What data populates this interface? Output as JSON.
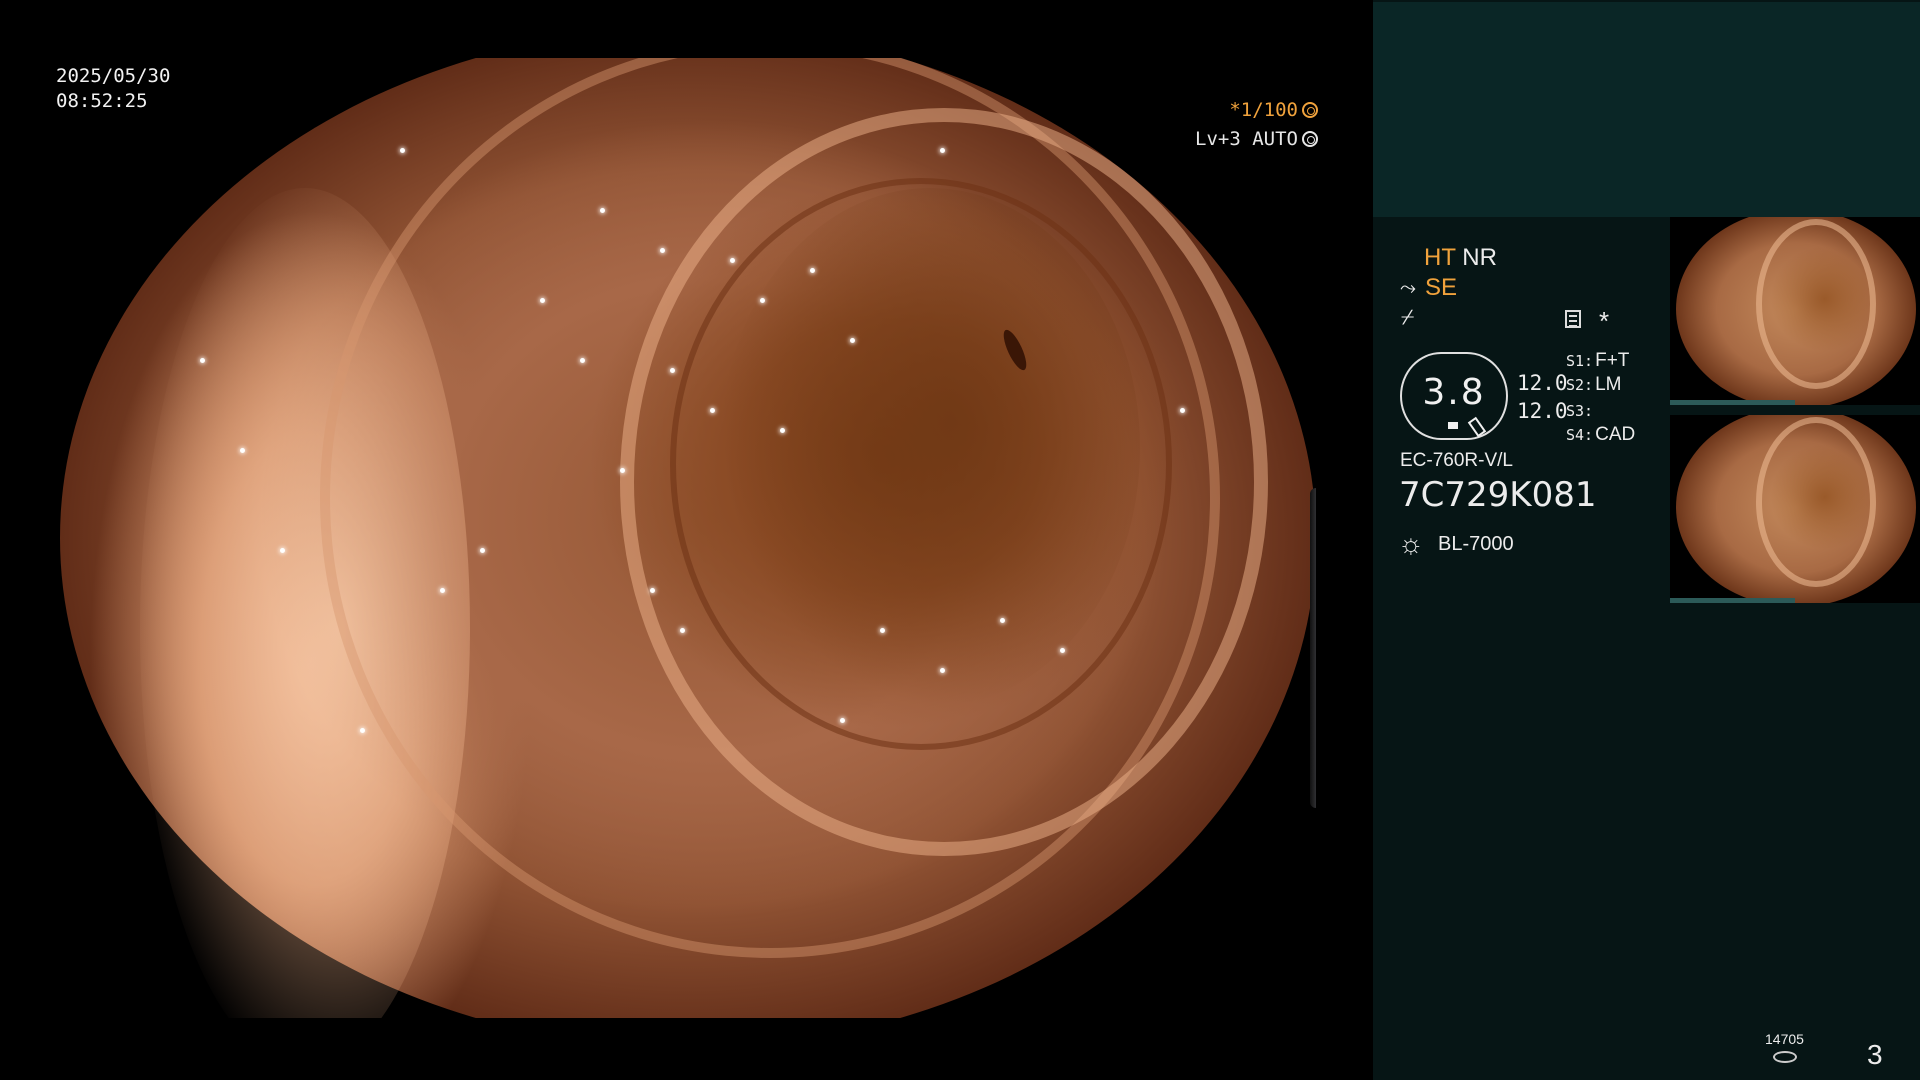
{
  "video_overlay": {
    "date": "2025/05/30",
    "time": "08:52:25",
    "shutter": "*1/100",
    "level": "Lv+3 AUTO",
    "shutter_icon": "aperture-icon",
    "level_icon": "iris-icon"
  },
  "processing": {
    "ht_label": "HT",
    "nr_label": "NR",
    "se_label": "SE",
    "se_icon": "structure-enhance-icon",
    "enhance_icon": "enhancement-icon",
    "menu_icon": "menu-icon",
    "asterisk": "*"
  },
  "zoom": {
    "value": "3.8",
    "line1": "12.0",
    "line2": "12.0"
  },
  "scope_switches": [
    {
      "key": "S1:",
      "value": "F+T"
    },
    {
      "key": "S2:",
      "value": "LM"
    },
    {
      "key": "S3:",
      "value": ""
    },
    {
      "key": "S4:",
      "value": "CAD"
    }
  ],
  "scope": {
    "model": "EC-760R-V/L",
    "serial": "7C729K081"
  },
  "light_source": {
    "icon": "sun-lamp-icon",
    "model": "BL-7000"
  },
  "footer": {
    "counter": "14705",
    "storage_icon": "storage-disk-icon",
    "page": "3"
  },
  "colors": {
    "accent_orange": "#f0a23c",
    "panel_bg": "#061515",
    "panel_top": "#0a2626"
  }
}
